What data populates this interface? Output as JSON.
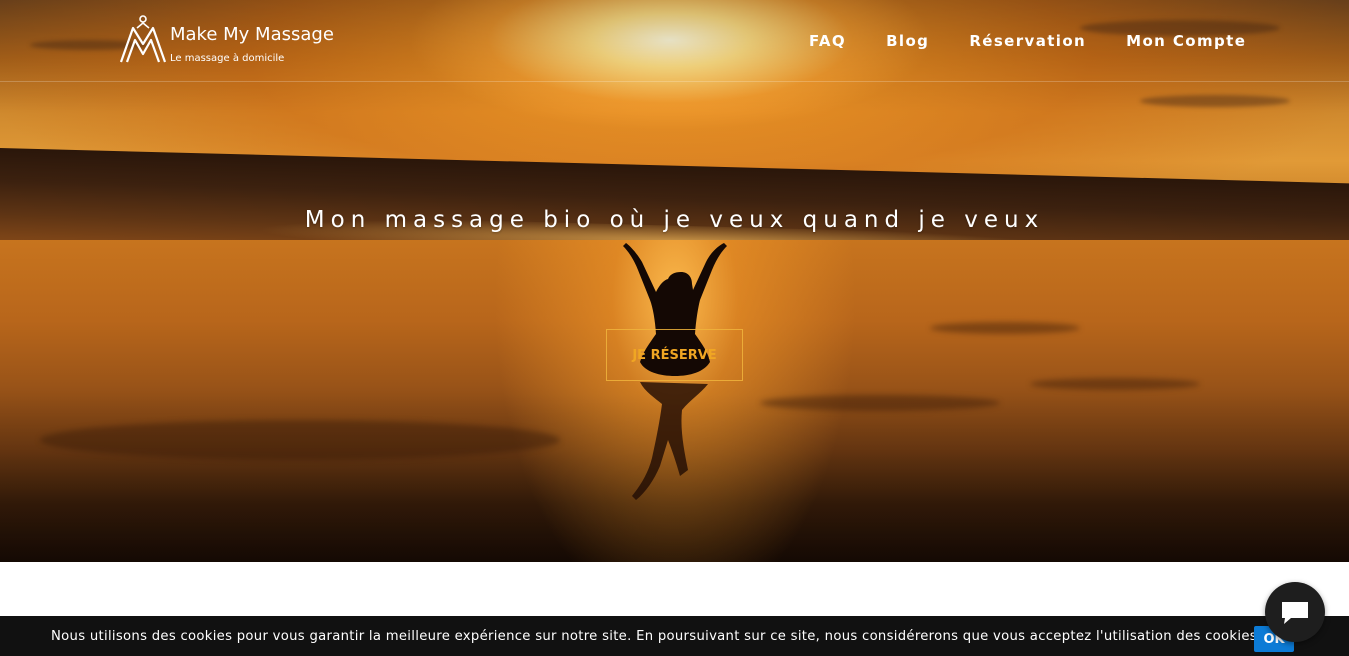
{
  "brand": {
    "name": "Make My Massage",
    "tagline": "Le massage à domicile",
    "logo_icon": "mm-logo-icon"
  },
  "nav": {
    "items": [
      {
        "label": "FAQ"
      },
      {
        "label": "Blog"
      },
      {
        "label": "Réservation"
      },
      {
        "label": "Mon Compte"
      }
    ]
  },
  "hero": {
    "title": "Mon massage bio où je veux quand je veux",
    "cta_label": "JE RÉSERVE"
  },
  "cookie_banner": {
    "text": "Nous utilisons des cookies pour vous garantir la meilleure expérience sur notre site. En poursuivant sur ce site, nous considérerons que vous acceptez l'utilisation des cookies.",
    "ok_label": "OK"
  },
  "chat": {
    "icon": "chat-bubble-icon"
  },
  "colors": {
    "accent": "#f0a623",
    "cookie_button": "#0c7bd6",
    "cookie_bar": "#111111"
  }
}
